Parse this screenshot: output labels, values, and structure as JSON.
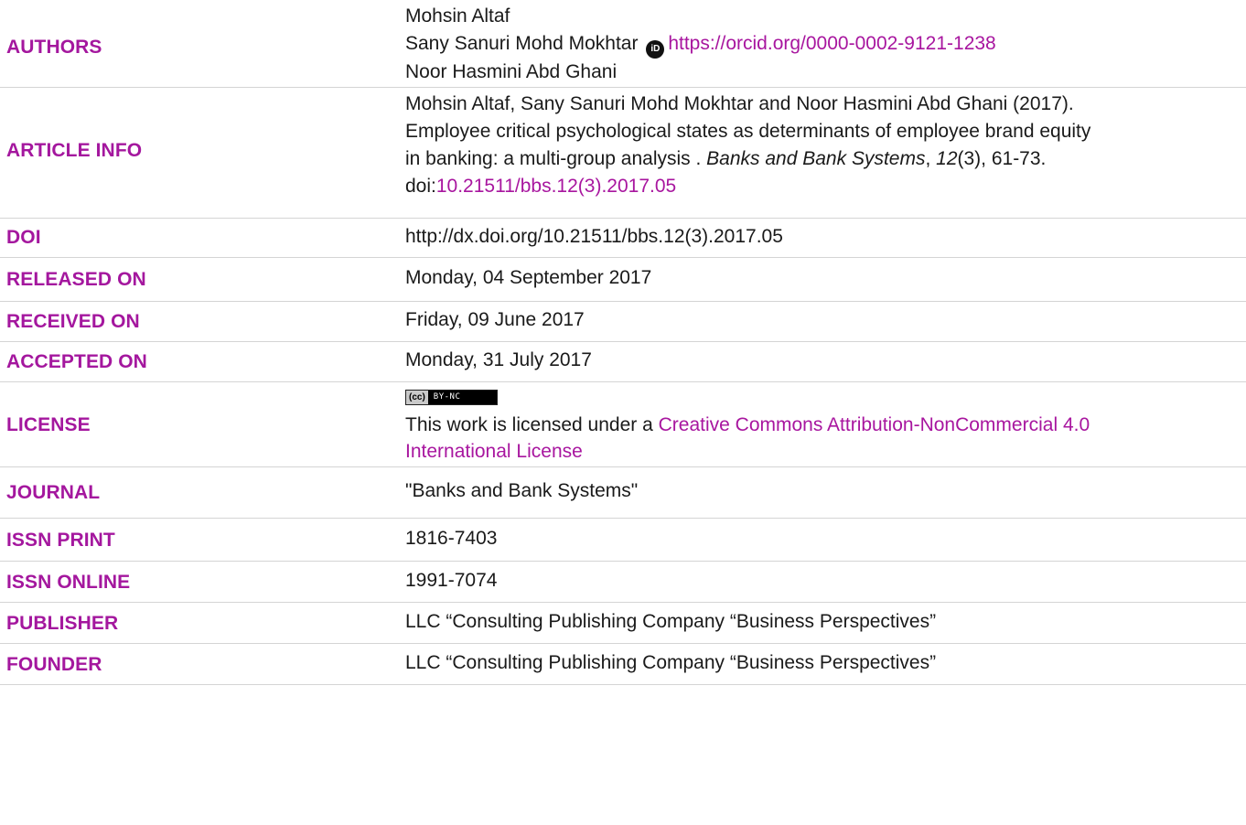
{
  "rows": {
    "authors": {
      "label": "AUTHORS",
      "names": [
        "Mohsin Altaf",
        "Sany Sanuri Mohd Mokhtar",
        "Noor Hasmini Abd Ghani"
      ],
      "orcid_icon_text": "iD",
      "orcid_url": "https://orcid.org/0000-0002-9121-1238"
    },
    "article_info": {
      "label": "ARTICLE INFO",
      "line1": "Mohsin Altaf, Sany Sanuri Mohd Mokhtar and Noor Hasmini Abd Ghani (2017).",
      "line2": "Employee critical psychological states as determinants of employee brand equity",
      "line3": "in banking: a multi-group analysis . ",
      "journal_italic": "Banks and Bank Systems",
      "sep1": ", ",
      "volume_italic": "12",
      "issue_pages": "(3), 61-73.",
      "doi_prefix": "doi:",
      "doi_link": "10.21511/bbs.12(3).2017.05"
    },
    "doi": {
      "label": "DOI",
      "value": "http://dx.doi.org/10.21511/bbs.12(3).2017.05"
    },
    "released_on": {
      "label": "RELEASED ON",
      "value": "Monday, 04 September 2017"
    },
    "received_on": {
      "label": "RECEIVED ON",
      "value": "Friday, 09 June 2017"
    },
    "accepted_on": {
      "label": "ACCEPTED ON",
      "value": "Monday, 31 July 2017"
    },
    "license": {
      "label": "LICENSE",
      "badge_cc": "(cc)",
      "badge_text": "BY-NC",
      "text_prefix": "This work is licensed under a ",
      "link_line1": "Creative Commons Attribution-NonCommercial 4.0",
      "link_line2": "International License"
    },
    "journal": {
      "label": "JOURNAL",
      "value": "\"Banks and Bank Systems\""
    },
    "issn_print": {
      "label": "ISSN PRINT",
      "value": "1816-7403"
    },
    "issn_online": {
      "label": "ISSN ONLINE",
      "value": "1991-7074"
    },
    "publisher": {
      "label": "PUBLISHER",
      "value": "LLC “Consulting Publishing Company “Business Perspectives”"
    },
    "founder": {
      "label": "FOUNDER",
      "value": "LLC “Consulting Publishing Company “Business Perspectives”"
    }
  },
  "colors": {
    "label": "#a4179e",
    "link": "#a8169f",
    "divider": "#d4d4d4",
    "text": "#1a1a1a"
  }
}
